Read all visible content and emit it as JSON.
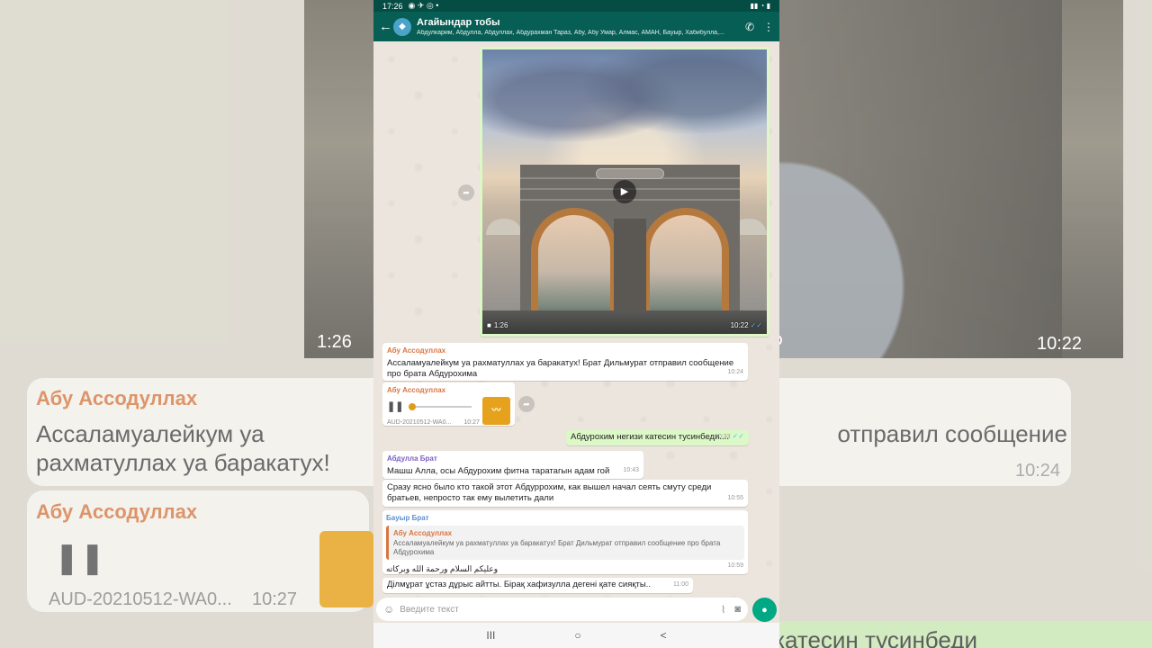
{
  "status": {
    "time": "17:26",
    "icons": "◉ ✈ ◎ •",
    "right": "▮▮ ◔ ▮"
  },
  "header": {
    "title": "Агайындар тобы",
    "subtitle": "Абдулкарим, Абдулла, Абдуллах, Абдурахман Тараз, Абу, Абу Умар, Алмас, АМАН, Бауыр, Хабибулла,...",
    "back_icon": "←",
    "call_icon": "✆",
    "menu_icon": "⋮"
  },
  "video_msg": {
    "duration": "1:26",
    "time": "10:22"
  },
  "msg1": {
    "sender": "Абу Ассодуллах",
    "sender_color": "#d9753f",
    "text": "Ассаламуалейкум уа рахматуллах уа баракатух! Брат Дильмурат отправил сообщение про брата Абдурохима",
    "time": "10:24"
  },
  "msg2": {
    "sender": "Абу Ассодуллах",
    "file": "AUD-20210512-WA0...",
    "time": "10:27"
  },
  "msg3": {
    "text": "Абдурохим негизи катесин тусинбеди....",
    "time": "10:33"
  },
  "msg4": {
    "sender": "Абдулла Брат",
    "sender_color": "#7a5cc4",
    "text": "Машш Алла, осы Абдурохим фитна таратагын адам гой",
    "time": "10:43"
  },
  "msg5": {
    "text": "Сразу ясно было кто такой этот Абдуррохим, как вышел начал сеять смуту среди братьев, непросто так ему вылетить дали",
    "time": "10:55"
  },
  "msg6": {
    "sender": "Бауыр Брат",
    "sender_color": "#5a8fcf",
    "quote_name": "Абу Ассодуллах",
    "quote_text": "Ассаламуалейкум уа рахматуллах уа баракатух! Брат Дильмурат отправил сообщение про брата Абдурохима",
    "text": "وعليكم السلام ورحمة الله وبركاته",
    "time": "10:59"
  },
  "msg7": {
    "text": "Ділмұрат ұстаз дұрыс айтты.  Бірақ хафизулла дегені қате сияқты..",
    "time": "11:00"
  },
  "input": {
    "placeholder": "Введите текст"
  },
  "navbar": {
    "recent": "III",
    "home": "○",
    "back": "<"
  },
  "background": {
    "name1": "Абу Ассодуллах",
    "text1": "Ассаламуалейкум уа рахматуллах уа баракатух! Брат Дильмурат отправил сообщение про брата Абдурохима",
    "time1": "10:24",
    "name2": "Абу Ассодуллах",
    "file2": "AUD-20210512-WA0...",
    "time2": "10:27",
    "vdur": "1:26",
    "vtime": "10:22",
    "sent": "катесин тусинбеди"
  }
}
